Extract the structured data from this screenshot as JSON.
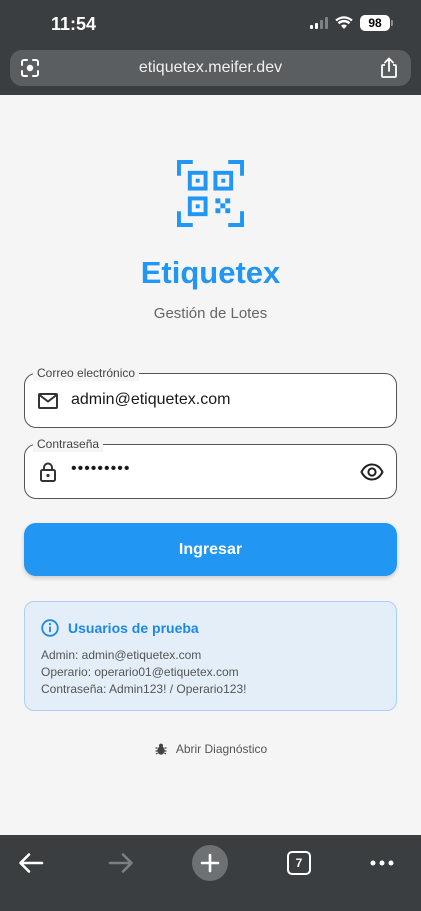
{
  "status_bar": {
    "time": "11:54",
    "battery": "98"
  },
  "browser": {
    "url": "etiquetex.meifer.dev"
  },
  "app": {
    "title": "Etiquetex",
    "subtitle": "Gestión de Lotes"
  },
  "form": {
    "email_label": "Correo electrónico",
    "email_value": "admin@etiquetex.com",
    "password_label": "Contraseña",
    "password_value": "•••••••••",
    "submit_label": "Ingresar"
  },
  "info": {
    "title": "Usuarios de prueba",
    "lines": [
      "Admin: admin@etiquetex.com",
      "Operario: operario01@etiquetex.com",
      "Contraseña: Admin123! / Operario123!"
    ]
  },
  "diagnostic_label": "Abrir Diagnóstico",
  "toolbar": {
    "tab_count": "7"
  },
  "colors": {
    "primary": "#2196f3",
    "info_bg": "#e3eef8",
    "chrome": "#3b3e40"
  }
}
